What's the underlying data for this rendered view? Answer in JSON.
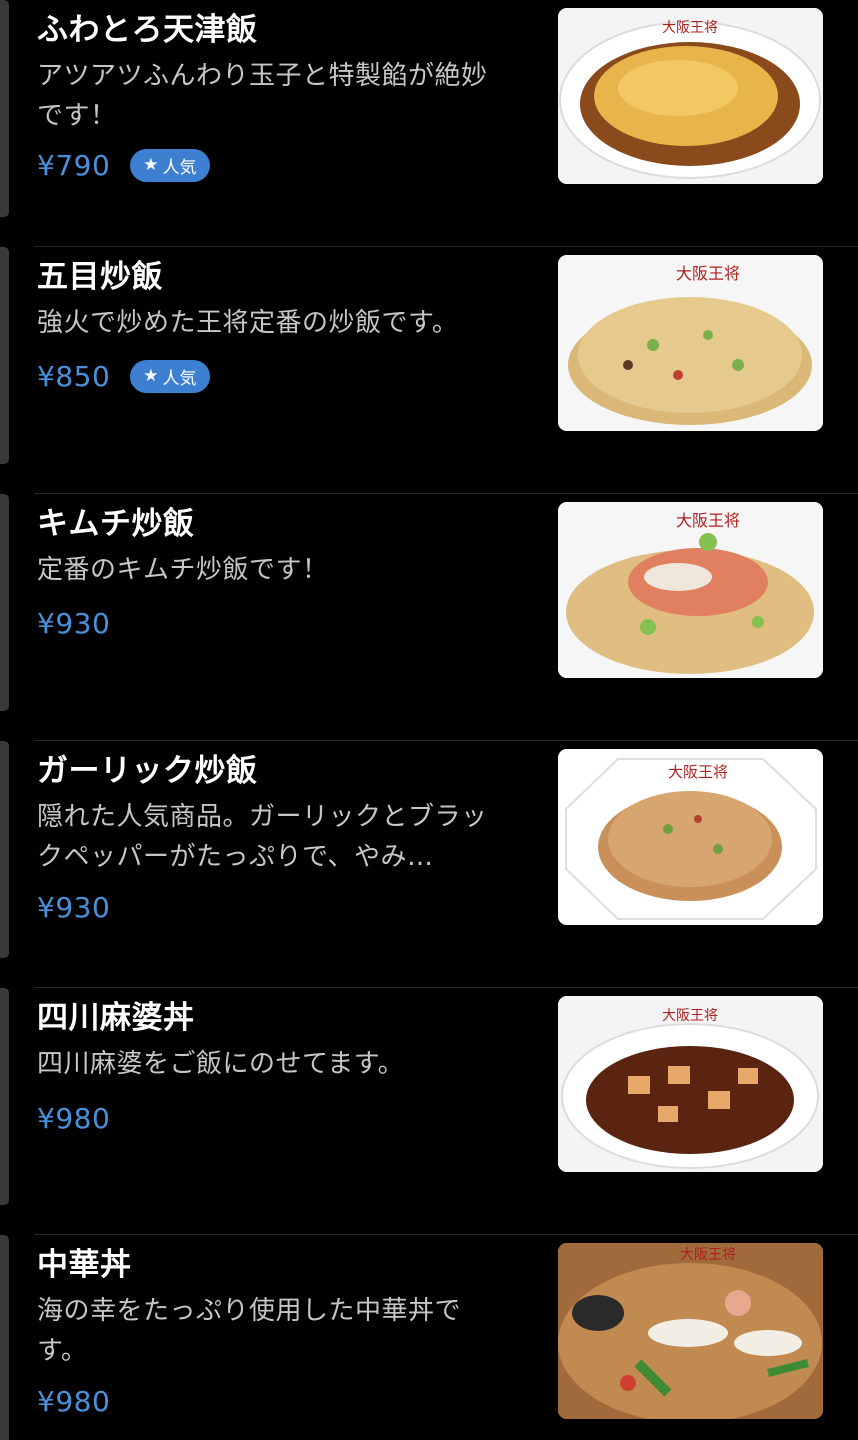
{
  "menu": {
    "items": [
      {
        "name": "ふわとろ天津飯",
        "description": "アツアツふんわり玉子と特製餡が絶妙です！",
        "price": "¥790",
        "badge": "人気",
        "badge_icon": "star-icon",
        "image_alt": "ふわとろ天津飯"
      },
      {
        "name": "五目炒飯",
        "description": "強火で炒めた王将定番の炒飯です。",
        "price": "¥850",
        "badge": "人気",
        "badge_icon": "star-icon",
        "image_alt": "五目炒飯"
      },
      {
        "name": "キムチ炒飯",
        "description": "定番のキムチ炒飯です！",
        "price": "¥930",
        "badge": null,
        "image_alt": "キムチ炒飯"
      },
      {
        "name": "ガーリック炒飯",
        "description": "隠れた人気商品。ガーリックとブラックペッパーがたっぷりで、やみ…",
        "price": "¥930",
        "badge": null,
        "image_alt": "ガーリック炒飯"
      },
      {
        "name": "四川麻婆丼",
        "description": "四川麻婆をご飯にのせてます。",
        "price": "¥980",
        "badge": null,
        "image_alt": "四川麻婆丼"
      },
      {
        "name": "中華丼",
        "description": "海の幸をたっぷり使用した中華丼です。",
        "price": "¥980",
        "badge": null,
        "image_alt": "中華丼"
      }
    ],
    "plate_brand": "大阪王将"
  },
  "colors": {
    "background": "#000000",
    "price": "#4a90d9",
    "badge": "#3d7fd0",
    "description": "#c6c6c8"
  }
}
